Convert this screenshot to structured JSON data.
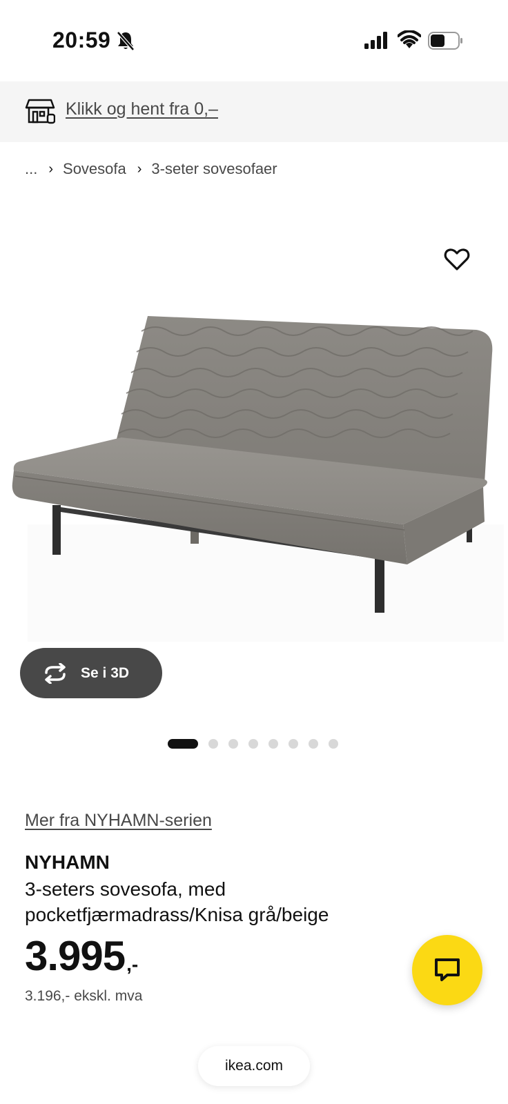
{
  "status_bar": {
    "time": "20:59",
    "icons": [
      "bell-slash-icon",
      "cellular-signal-icon",
      "wifi-icon",
      "battery-icon"
    ]
  },
  "promo": {
    "icon": "store-pickup-icon",
    "text": "Klikk og hent fra 0,–"
  },
  "breadcrumb": {
    "ellipsis": "...",
    "items": [
      "Sovesofa",
      "3-seter sovesofaer"
    ]
  },
  "gallery": {
    "favorite_icon": "heart-icon",
    "view_3d_label": "Se i 3D",
    "view_3d_icon": "rotate-icon",
    "slide_count": 8,
    "active_slide": 1
  },
  "product": {
    "series_link": "Mer fra NYHAMN-serien",
    "name": "NYHAMN",
    "description": "3-seters sovesofa, med pocketfjærmadrass/Knisa grå/beige",
    "price": "3.995",
    "price_suffix": ",-",
    "price_ex_vat": "3.196,- ekskl. mva"
  },
  "chat": {
    "icon": "chat-bubble-icon",
    "color": "#fbd914"
  },
  "browser": {
    "url": "ikea.com"
  },
  "colors": {
    "promo_bg": "#f5f5f5",
    "button_dark": "#484848",
    "accent_yellow": "#fbd914",
    "text_dark": "#111111",
    "sofa_fabric": "#8a8782",
    "sofa_legs": "#2e2e2e"
  }
}
